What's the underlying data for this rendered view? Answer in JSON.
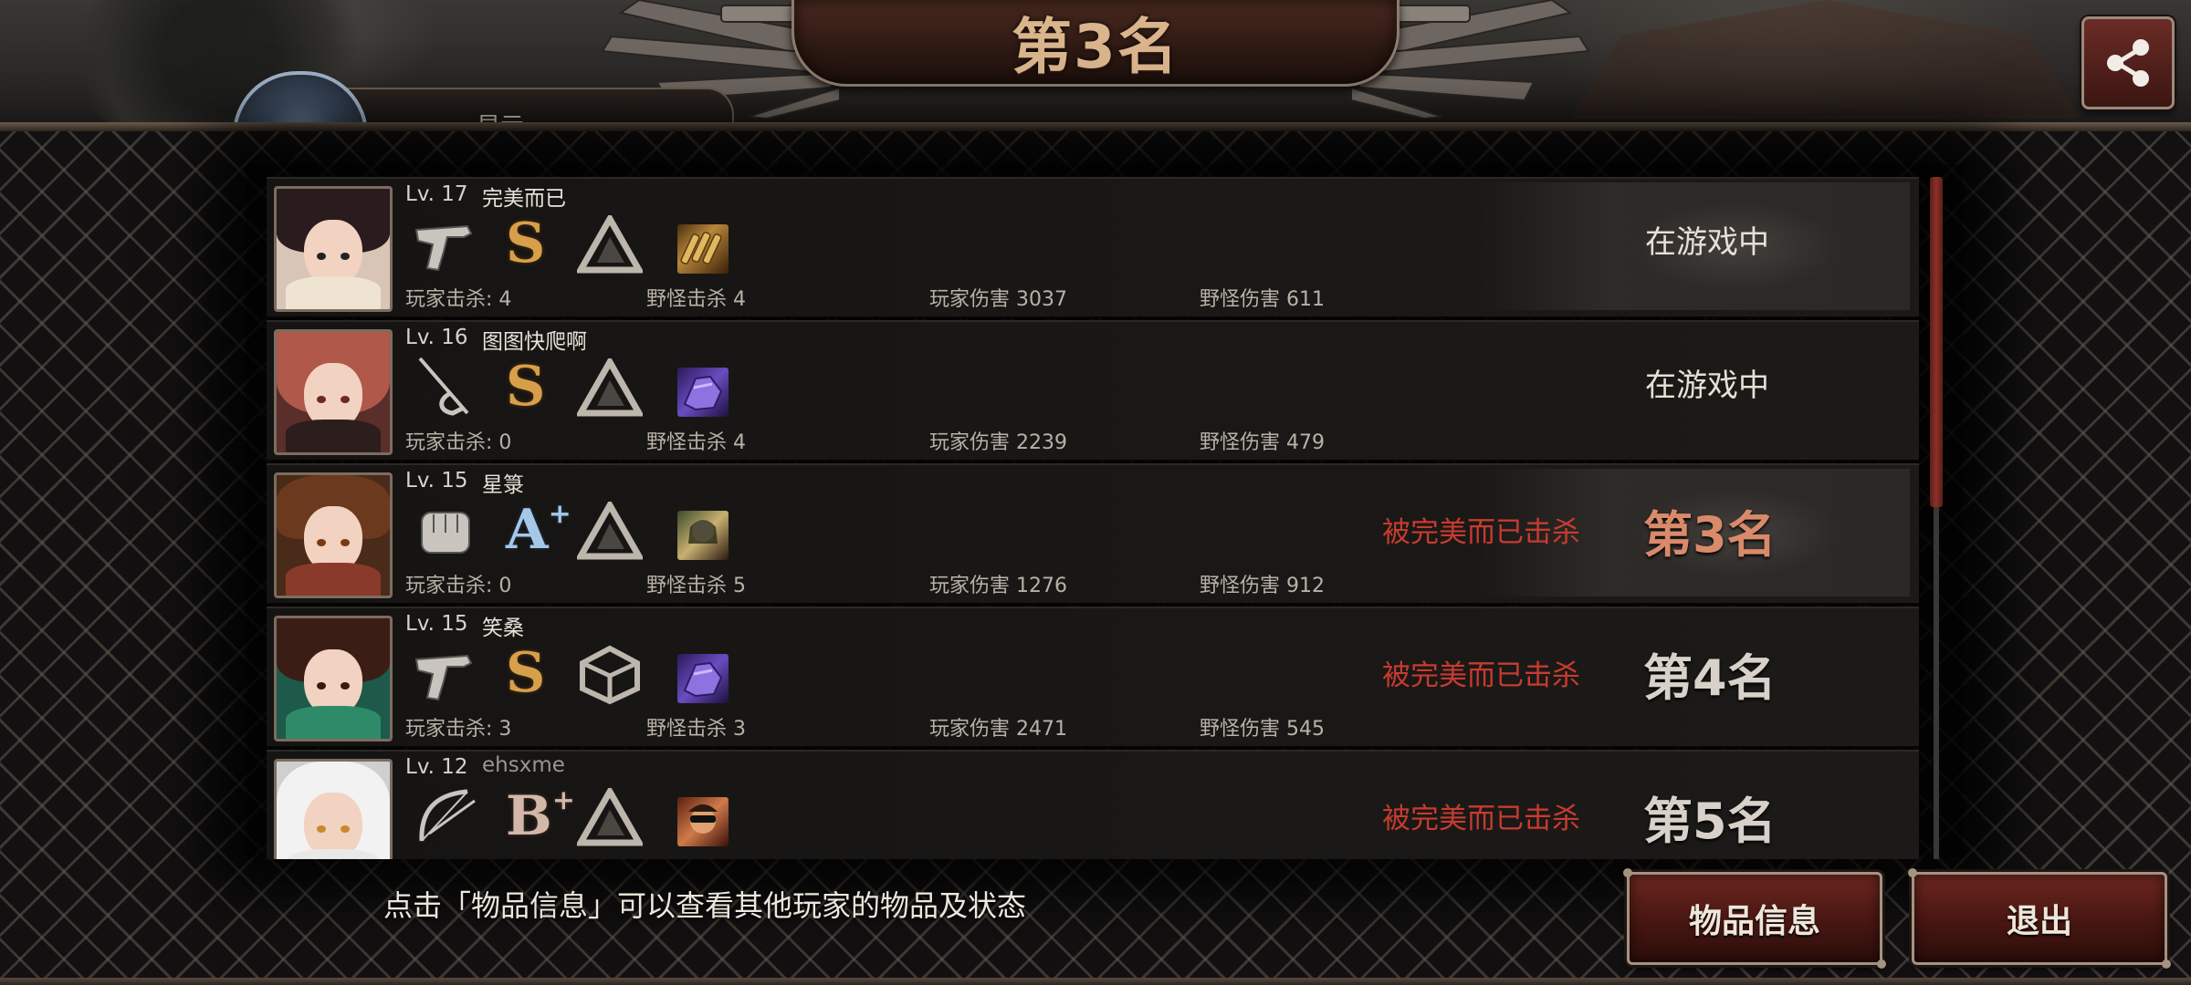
{
  "header": {
    "title": "第3名",
    "share_icon": "share-icon",
    "profile_tab_label": "显示"
  },
  "players": [
    {
      "level": "Lv. 17",
      "name": "完美而已",
      "weapon_icon": "pistol-icon",
      "grade": "S",
      "grade_plus": "",
      "tier_icon": "triangle-tier-icon",
      "item_icon": "bullets-item-icon",
      "player_kills": "玩家击杀: 4",
      "monster_kills": "野怪击杀 4",
      "player_damage": "玩家伤害 3037",
      "monster_damage": "野怪伤害 611",
      "status": "在游戏中",
      "killed_by": "",
      "place": ""
    },
    {
      "level": "Lv. 16",
      "name": "图图快爬啊",
      "weapon_icon": "rapier-icon",
      "grade": "S",
      "grade_plus": "",
      "tier_icon": "triangle-tier-icon",
      "item_icon": "purple-armor-item-icon",
      "player_kills": "玩家击杀: 0",
      "monster_kills": "野怪击杀 4",
      "player_damage": "玩家伤害 2239",
      "monster_damage": "野怪伤害 479",
      "status": "在游戏中",
      "killed_by": "",
      "place": ""
    },
    {
      "level": "Lv. 15",
      "name": "星箓",
      "weapon_icon": "fist-icon",
      "grade": "A",
      "grade_plus": "+",
      "tier_icon": "triangle-tier-icon",
      "item_icon": "character-item-icon",
      "player_kills": "玩家击杀: 0",
      "monster_kills": "野怪击杀 5",
      "player_damage": "玩家伤害 1276",
      "monster_damage": "野怪伤害 912",
      "status": "",
      "killed_by": "被完美而已击杀",
      "place": "第3名"
    },
    {
      "level": "Lv. 15",
      "name": "笑桑",
      "weapon_icon": "pistol-icon",
      "grade": "S",
      "grade_plus": "",
      "tier_icon": "cube-tier-icon",
      "item_icon": "purple-armor-item-icon",
      "player_kills": "玩家击杀: 3",
      "monster_kills": "野怪击杀 3",
      "player_damage": "玩家伤害 2471",
      "monster_damage": "野怪伤害 545",
      "status": "",
      "killed_by": "被完美而已击杀",
      "place": "第4名"
    },
    {
      "level": "Lv. 12",
      "name": "ehsxme",
      "weapon_icon": "bow-icon",
      "grade": "B",
      "grade_plus": "+",
      "tier_icon": "triangle-tier-icon",
      "item_icon": "sunglasses-character-item-icon",
      "player_kills": "",
      "monster_kills": "",
      "player_damage": "",
      "monster_damage": "",
      "status": "",
      "killed_by": "被完美而已击杀",
      "place": "第5名"
    }
  ],
  "footer": {
    "hint": "点击「物品信息」可以查看其他玩家的物品及状态",
    "item_info_label": "物品信息",
    "exit_label": "退出"
  },
  "colors": {
    "killed_text": "#c73b2f",
    "grade_s": "#d89f4a",
    "grade_a": "#a6c8e6",
    "grade_b": "#d3b7a8",
    "button_red": "#6d2720"
  }
}
